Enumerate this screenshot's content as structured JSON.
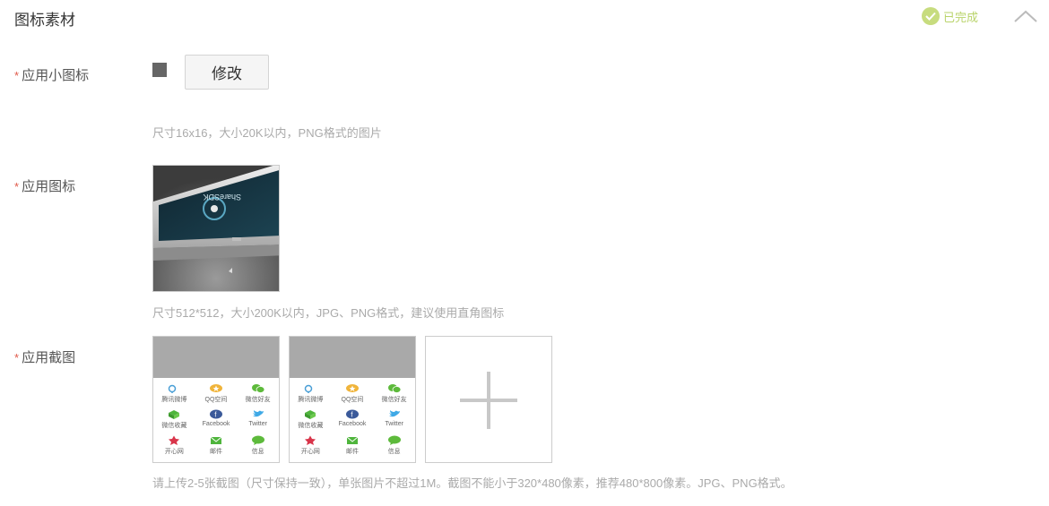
{
  "section": {
    "title": "图标素材",
    "status": "已完成",
    "status_color": "#b9d36a"
  },
  "small_icon": {
    "label": "应用小图标",
    "required_mark": "*",
    "modify_label": "修改",
    "hint": "尺寸16x16，大小20K以内，PNG格式的图片"
  },
  "app_icon": {
    "label": "应用图标",
    "required_mark": "*",
    "preview_text": "ShareSDK",
    "hint": "尺寸512*512，大小200K以内，JPG、PNG格式，建议使用直角图标"
  },
  "screenshots": {
    "label": "应用截图",
    "required_mark": "*",
    "items": [
      {
        "apps": [
          {
            "name": "腾讯微博",
            "icon": "tencent-weibo-icon",
            "color": "#4a9fd6"
          },
          {
            "name": "QQ空间",
            "icon": "qzone-icon",
            "color": "#f0b43a"
          },
          {
            "name": "微信好友",
            "icon": "wechat-icon",
            "color": "#5dba3b"
          },
          {
            "name": "微信收藏",
            "icon": "wechat-favorite-icon",
            "color": "#4fb53c"
          },
          {
            "name": "Facebook",
            "icon": "facebook-icon",
            "color": "#3b5a9a"
          },
          {
            "name": "Twitter",
            "icon": "twitter-icon",
            "color": "#3fa9e6"
          },
          {
            "name": "开心网",
            "icon": "kaixin-icon",
            "color": "#d9354a"
          },
          {
            "name": "邮件",
            "icon": "mail-icon",
            "color": "#4fb53c"
          },
          {
            "name": "信息",
            "icon": "sms-icon",
            "color": "#5dba3b"
          }
        ]
      },
      {
        "apps": [
          {
            "name": "腾讯微博",
            "icon": "tencent-weibo-icon",
            "color": "#4a9fd6"
          },
          {
            "name": "QQ空间",
            "icon": "qzone-icon",
            "color": "#f0b43a"
          },
          {
            "name": "微信好友",
            "icon": "wechat-icon",
            "color": "#5dba3b"
          },
          {
            "name": "微信收藏",
            "icon": "wechat-favorite-icon",
            "color": "#4fb53c"
          },
          {
            "name": "Facebook",
            "icon": "facebook-icon",
            "color": "#3b5a9a"
          },
          {
            "name": "Twitter",
            "icon": "twitter-icon",
            "color": "#3fa9e6"
          },
          {
            "name": "开心网",
            "icon": "kaixin-icon",
            "color": "#d9354a"
          },
          {
            "name": "邮件",
            "icon": "mail-icon",
            "color": "#4fb53c"
          },
          {
            "name": "信息",
            "icon": "sms-icon",
            "color": "#5dba3b"
          }
        ]
      }
    ],
    "add_icon": "plus-icon",
    "hint": "请上传2-5张截图（尺寸保持一致），单张图片不超过1M。截图不能小于320*480像素，推荐480*800像素。JPG、PNG格式。"
  },
  "colors": {
    "required": "#e05a4a",
    "hint": "#aaaaaa"
  }
}
